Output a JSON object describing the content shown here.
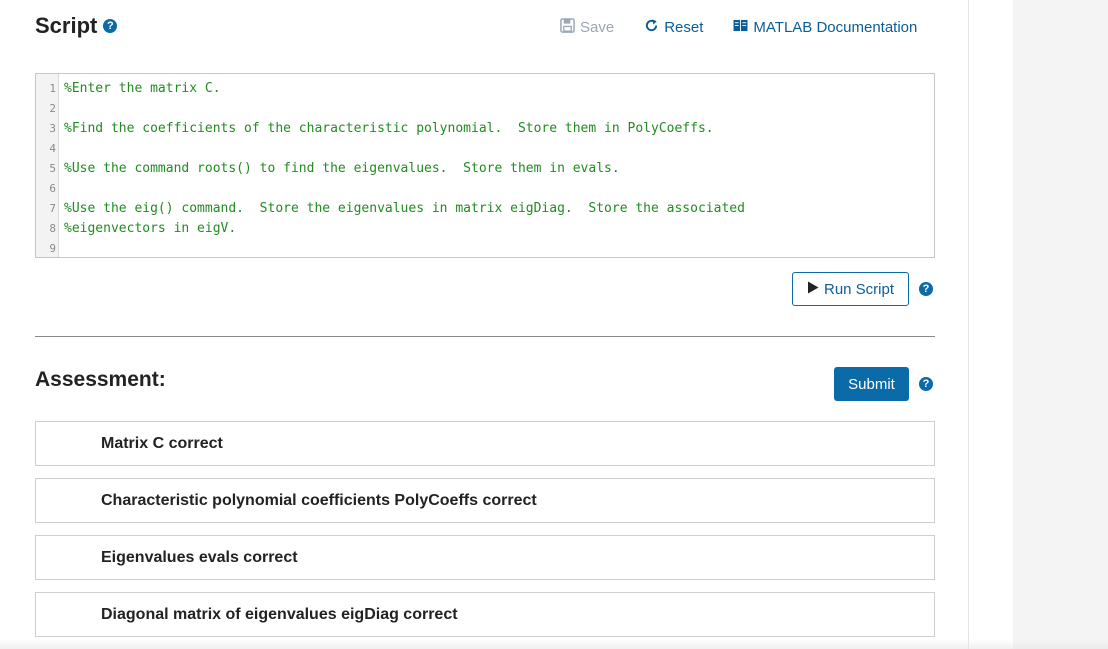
{
  "script": {
    "title": "Script",
    "help_glyph": "?"
  },
  "toolbar": {
    "save_label": "Save",
    "reset_label": "Reset",
    "docs_label": "MATLAB Documentation"
  },
  "editor": {
    "lines": [
      {
        "num": "1",
        "text": "%Enter the matrix C."
      },
      {
        "num": "2",
        "text": ""
      },
      {
        "num": "3",
        "text": "%Find the coefficients of the characteristic polynomial.  Store them in PolyCoeffs."
      },
      {
        "num": "4",
        "text": ""
      },
      {
        "num": "5",
        "text": "%Use the command roots() to find the eigenvalues.  Store them in evals."
      },
      {
        "num": "6",
        "text": ""
      },
      {
        "num": "7",
        "text": "%Use the eig() command.  Store the eigenvalues in matrix eigDiag.  Store the associated"
      },
      {
        "num": "8",
        "text": "%eigenvectors in eigV."
      },
      {
        "num": "9",
        "text": ""
      }
    ]
  },
  "run": {
    "label": "Run Script",
    "help_glyph": "?"
  },
  "assessment": {
    "title": "Assessment:",
    "submit_label": "Submit",
    "help_glyph": "?",
    "items": [
      "Matrix C correct",
      "Characteristic polynomial coefficients PolyCoeffs correct",
      "Eigenvalues evals correct",
      "Diagonal matrix of eigenvalues eigDiag correct"
    ]
  },
  "colors": {
    "accent": "#0b6aa8",
    "comment_green": "#228b22",
    "disabled": "#9aa7b5"
  }
}
